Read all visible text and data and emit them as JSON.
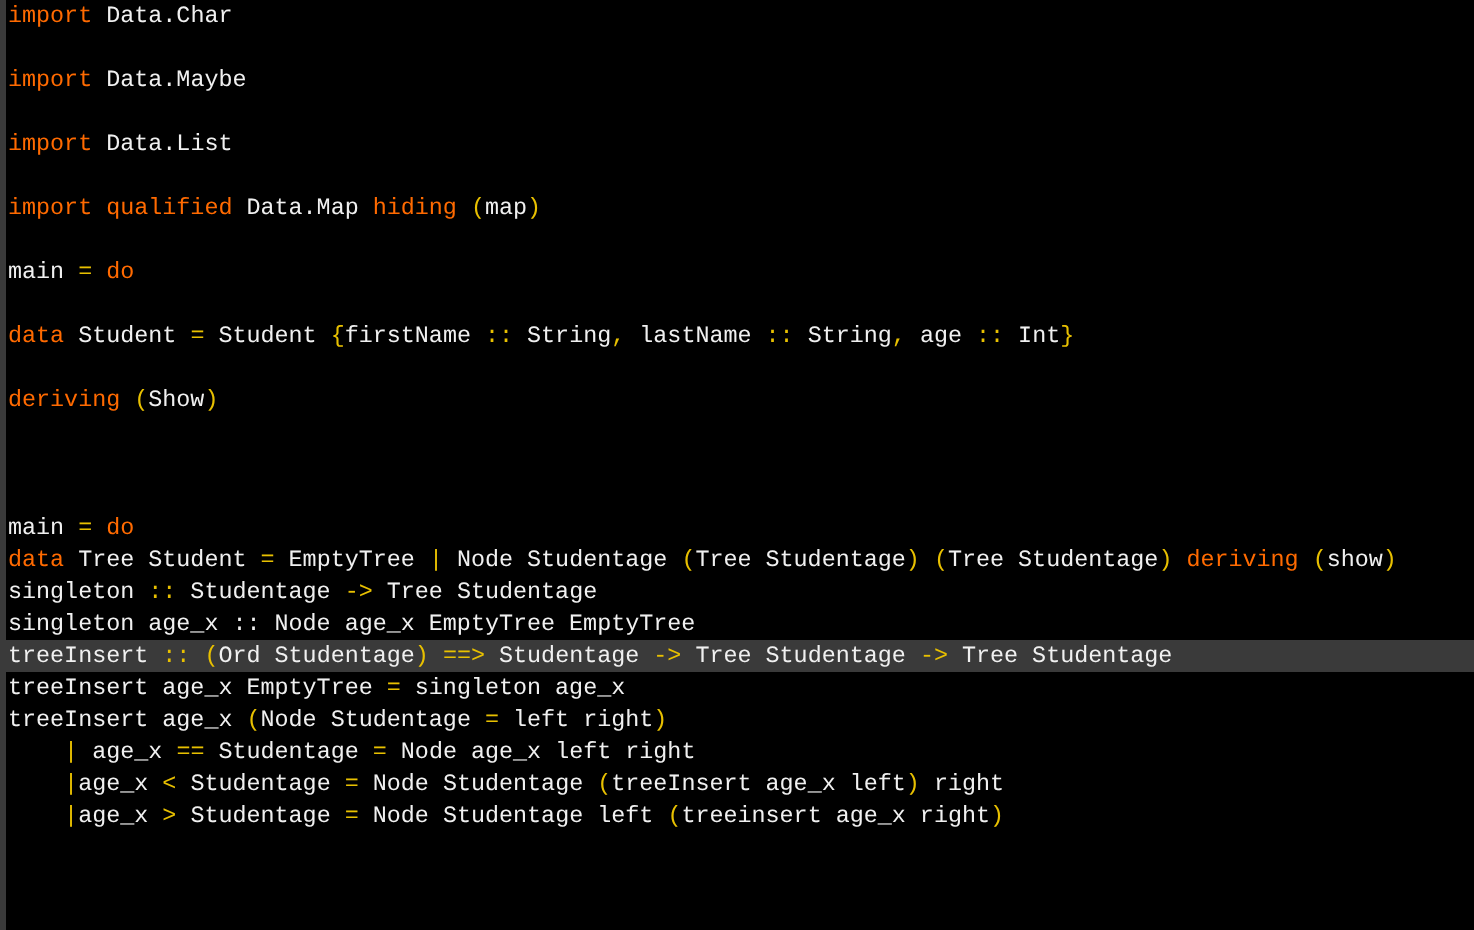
{
  "editor": {
    "lines": [
      {
        "highlighted": false,
        "tokens": [
          {
            "kind": "keyword",
            "text": "import"
          },
          {
            "kind": "text",
            "text": " Data.Char"
          }
        ]
      },
      {
        "highlighted": false
      },
      {
        "highlighted": false,
        "tokens": [
          {
            "kind": "keyword",
            "text": "import"
          },
          {
            "kind": "text",
            "text": " Data.Maybe"
          }
        ]
      },
      {
        "highlighted": false
      },
      {
        "highlighted": false,
        "tokens": [
          {
            "kind": "keyword",
            "text": "import"
          },
          {
            "kind": "text",
            "text": " Data.List"
          }
        ]
      },
      {
        "highlighted": false
      },
      {
        "highlighted": false,
        "tokens": [
          {
            "kind": "keyword",
            "text": "import qualified"
          },
          {
            "kind": "text",
            "text": " Data.Map "
          },
          {
            "kind": "keyword",
            "text": "hiding"
          },
          {
            "kind": "operator",
            "text": " ("
          },
          {
            "kind": "text",
            "text": "map"
          },
          {
            "kind": "operator",
            "text": ")"
          }
        ]
      },
      {
        "highlighted": false
      },
      {
        "highlighted": false,
        "tokens": [
          {
            "kind": "text",
            "text": "main "
          },
          {
            "kind": "operator",
            "text": "="
          },
          {
            "kind": "keyword",
            "text": " do"
          }
        ]
      },
      {
        "highlighted": false
      },
      {
        "highlighted": false,
        "tokens": [
          {
            "kind": "keyword",
            "text": "data"
          },
          {
            "kind": "text",
            "text": " Student "
          },
          {
            "kind": "operator",
            "text": "="
          },
          {
            "kind": "text",
            "text": " Student "
          },
          {
            "kind": "operator",
            "text": "{"
          },
          {
            "kind": "text",
            "text": "firstName "
          },
          {
            "kind": "operator",
            "text": "::"
          },
          {
            "kind": "text",
            "text": " String"
          },
          {
            "kind": "operator",
            "text": ","
          },
          {
            "kind": "text",
            "text": " lastName "
          },
          {
            "kind": "operator",
            "text": "::"
          },
          {
            "kind": "text",
            "text": " String"
          },
          {
            "kind": "operator",
            "text": ","
          },
          {
            "kind": "text",
            "text": " age "
          },
          {
            "kind": "operator",
            "text": "::"
          },
          {
            "kind": "text",
            "text": " Int"
          },
          {
            "kind": "operator",
            "text": "}"
          }
        ]
      },
      {
        "highlighted": false
      },
      {
        "highlighted": false,
        "tokens": [
          {
            "kind": "keyword",
            "text": "deriving"
          },
          {
            "kind": "operator",
            "text": " ("
          },
          {
            "kind": "text",
            "text": "Show"
          },
          {
            "kind": "operator",
            "text": ")"
          }
        ]
      },
      {
        "highlighted": false
      },
      {
        "highlighted": false
      },
      {
        "highlighted": false
      },
      {
        "highlighted": false,
        "tokens": [
          {
            "kind": "text",
            "text": "main "
          },
          {
            "kind": "operator",
            "text": "="
          },
          {
            "kind": "keyword",
            "text": " do"
          }
        ]
      },
      {
        "highlighted": false,
        "tokens": [
          {
            "kind": "keyword",
            "text": "data"
          },
          {
            "kind": "text",
            "text": " Tree Student "
          },
          {
            "kind": "operator",
            "text": "="
          },
          {
            "kind": "text",
            "text": " EmptyTree "
          },
          {
            "kind": "operator",
            "text": "|"
          },
          {
            "kind": "text",
            "text": " Node Studentage "
          },
          {
            "kind": "operator",
            "text": "("
          },
          {
            "kind": "text",
            "text": "Tree Studentage"
          },
          {
            "kind": "operator",
            "text": ")"
          },
          {
            "kind": "operator",
            "text": " ("
          },
          {
            "kind": "text",
            "text": "Tree Studentage"
          },
          {
            "kind": "operator",
            "text": ")"
          },
          {
            "kind": "keyword",
            "text": " deriving"
          },
          {
            "kind": "operator",
            "text": " ("
          },
          {
            "kind": "text",
            "text": "show"
          },
          {
            "kind": "operator",
            "text": ")"
          }
        ]
      },
      {
        "highlighted": false,
        "tokens": [
          {
            "kind": "text",
            "text": "singleton "
          },
          {
            "kind": "operator",
            "text": "::"
          },
          {
            "kind": "text",
            "text": " Studentage "
          },
          {
            "kind": "operator",
            "text": "->"
          },
          {
            "kind": "text",
            "text": " Tree Studentage"
          }
        ]
      },
      {
        "highlighted": false,
        "tokens": [
          {
            "kind": "text",
            "text": "singleton age_x :: Node age_x EmptyTree EmptyTree"
          }
        ]
      },
      {
        "highlighted": true,
        "tokens": [
          {
            "kind": "text",
            "text": "treeInsert "
          },
          {
            "kind": "operator",
            "text": "::"
          },
          {
            "kind": "operator",
            "text": " ("
          },
          {
            "kind": "text",
            "text": "Ord Studentage"
          },
          {
            "kind": "operator",
            "text": ")"
          },
          {
            "kind": "operator",
            "text": " ==>"
          },
          {
            "kind": "text",
            "text": " Studentage "
          },
          {
            "kind": "operator",
            "text": "->"
          },
          {
            "kind": "text",
            "text": " Tree Studentage "
          },
          {
            "kind": "operator",
            "text": "->"
          },
          {
            "kind": "text",
            "text": " Tree Studentage"
          }
        ]
      },
      {
        "highlighted": false,
        "tokens": [
          {
            "kind": "text",
            "text": "treeInsert age_x EmptyTree "
          },
          {
            "kind": "operator",
            "text": "="
          },
          {
            "kind": "text",
            "text": " singleton age_x"
          }
        ]
      },
      {
        "highlighted": false,
        "tokens": [
          {
            "kind": "text",
            "text": "treeInsert age_x "
          },
          {
            "kind": "operator",
            "text": "("
          },
          {
            "kind": "text",
            "text": "Node Studentage "
          },
          {
            "kind": "operator",
            "text": "="
          },
          {
            "kind": "text",
            "text": " left right"
          },
          {
            "kind": "operator",
            "text": ")"
          }
        ]
      },
      {
        "highlighted": false,
        "tokens": [
          {
            "kind": "operator",
            "text": "    |"
          },
          {
            "kind": "text",
            "text": " age_x "
          },
          {
            "kind": "operator",
            "text": "=="
          },
          {
            "kind": "text",
            "text": " Studentage "
          },
          {
            "kind": "operator",
            "text": "="
          },
          {
            "kind": "text",
            "text": " Node age_x left right"
          }
        ]
      },
      {
        "highlighted": false,
        "tokens": [
          {
            "kind": "operator",
            "text": "    |"
          },
          {
            "kind": "text",
            "text": "age_x "
          },
          {
            "kind": "operator",
            "text": "<"
          },
          {
            "kind": "text",
            "text": " Studentage "
          },
          {
            "kind": "operator",
            "text": "="
          },
          {
            "kind": "text",
            "text": " Node Studentage "
          },
          {
            "kind": "operator",
            "text": "("
          },
          {
            "kind": "text",
            "text": "treeInsert age_x left"
          },
          {
            "kind": "operator",
            "text": ")"
          },
          {
            "kind": "text",
            "text": " right"
          }
        ]
      },
      {
        "highlighted": false,
        "tokens": [
          {
            "kind": "operator",
            "text": "    |"
          },
          {
            "kind": "text",
            "text": "age_x "
          },
          {
            "kind": "operator",
            "text": ">"
          },
          {
            "kind": "text",
            "text": " Studentage "
          },
          {
            "kind": "operator",
            "text": "="
          },
          {
            "kind": "text",
            "text": " Node Studentage left "
          },
          {
            "kind": "operator",
            "text": "("
          },
          {
            "kind": "text",
            "text": "treeinsert age_x right"
          },
          {
            "kind": "operator",
            "text": ")"
          }
        ]
      }
    ]
  }
}
